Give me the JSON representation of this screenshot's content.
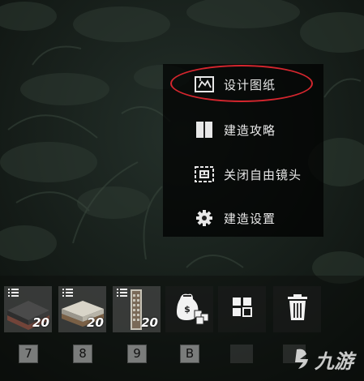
{
  "menu": {
    "items": [
      {
        "label": "设计图纸",
        "icon": "blueprint-icon"
      },
      {
        "label": "建造攻略",
        "icon": "book-icon"
      },
      {
        "label": "关闭自由镜头",
        "icon": "camera-frame-icon"
      },
      {
        "label": "建造设置",
        "icon": "gear-icon"
      }
    ],
    "highlighted_index": 0,
    "highlight_color": "#d5262e"
  },
  "hotbar": {
    "slots": [
      {
        "item": "stone-floor",
        "count": "20",
        "key": "7"
      },
      {
        "item": "wood-floor",
        "count": "20",
        "key": "8"
      },
      {
        "item": "stone-pillar",
        "count": "20",
        "key": "9"
      },
      {
        "item": "resource-bag",
        "count": "",
        "key": "B"
      },
      {
        "item": "grid-menu",
        "count": "",
        "key": ""
      },
      {
        "item": "trash",
        "count": "",
        "key": ""
      }
    ]
  },
  "watermark": {
    "text": "九游"
  },
  "colors": {
    "menu_bg": "#000000",
    "foliage": "#1c2a20",
    "accent_red": "#d5262e"
  }
}
